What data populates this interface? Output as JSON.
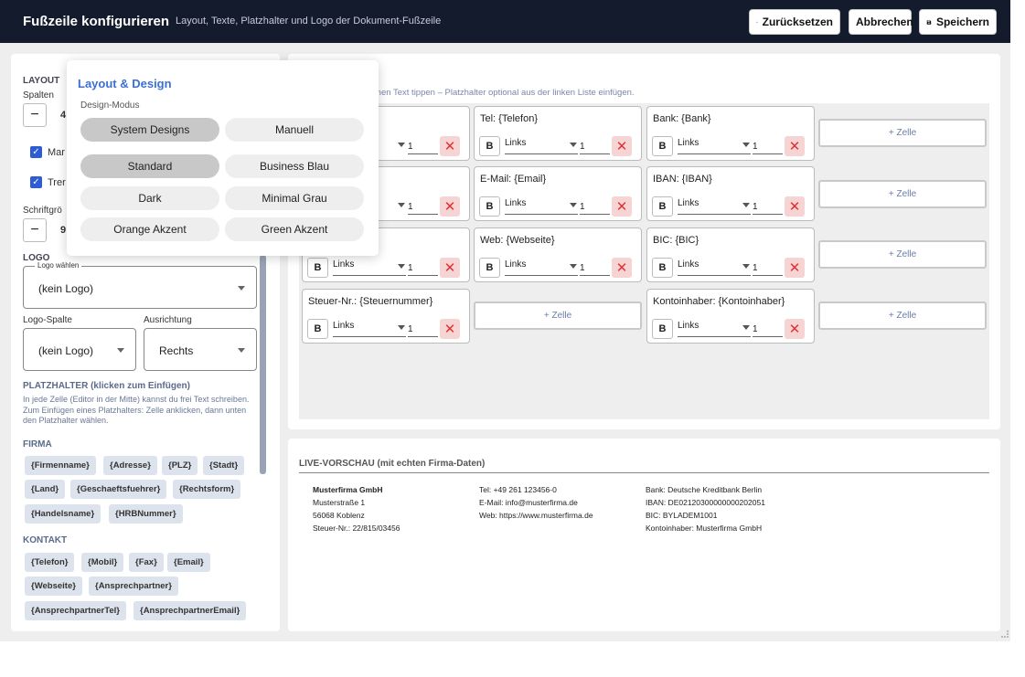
{
  "header": {
    "title": "Fußzeile konfigurieren",
    "subtitle": "Layout, Texte, Platzhalter und Logo der Dokument-Fußzeile",
    "reset_label": "Zurücksetzen",
    "cancel_label": "Abbrechen",
    "save_label": "Speichern"
  },
  "sidebar": {
    "layout_heading": "LAYOUT",
    "columns_label": "Spalten",
    "columns_value": "4",
    "checkbox1_label": "Mar",
    "checkbox2_label": "Trer",
    "fontsize_label": "Schriftgrö",
    "fontsize_value": "9",
    "logo_heading": "LOGO",
    "logo_select_legend": "Logo wählen",
    "logo_select_value": "(kein Logo)",
    "logo_column_label": "Logo-Spalte",
    "logo_column_value": "(kein Logo)",
    "alignment_label": "Ausrichtung",
    "alignment_value": "Rechts",
    "placeholder_heading": "PLATZHALTER (klicken zum Einfügen)",
    "placeholder_hint": "In jede Zelle (Editor in der Mitte) kannst du frei Text schreiben. Zum Einfügen eines Platzhalters: Zelle anklicken, dann unten den Platzhalter wählen.",
    "firma_heading": "FIRMA",
    "firma_chips": [
      "{Firmenname}",
      "{Adresse}",
      "{PLZ}",
      "{Stadt}",
      "{Land}",
      "{Geschaeftsfuehrer}",
      "{Rechtsform}",
      "{Handelsname}",
      "{HRBNummer}"
    ],
    "kontakt_heading": "KONTAKT",
    "kontakt_chips": [
      "{Telefon}",
      "{Mobil}",
      "{Fax}",
      "{Email}",
      "{Webseite}",
      "{Ansprechpartner}",
      "{AnsprechpartnerTel}",
      "{AnsprechpartnerEmail}"
    ]
  },
  "popover": {
    "title": "Layout & Design",
    "mode_label": "Design-Modus",
    "mode_options": [
      "System Designs",
      "Manuell"
    ],
    "designs": [
      "Standard",
      "Business Blau",
      "Dark",
      "Minimal Grau",
      "Orange Akzent",
      "Green Akzent"
    ]
  },
  "editor": {
    "hint": "igenen Text tippen – Platzhalter optional aus der linken Liste einfügen.",
    "bold_label": "B",
    "delete_symbol": "✕",
    "add_cell_label": "+ Zelle",
    "cells": [
      {
        "text": "",
        "align": "",
        "span": "1"
      },
      {
        "text": "Tel: {Telefon}",
        "align": "Links",
        "span": "1"
      },
      {
        "text": "Bank: {Bank}",
        "align": "Links",
        "span": "1"
      },
      {
        "text": "",
        "align": "",
        "span": "1"
      },
      {
        "text": "E-Mail: {Email}",
        "align": "Links",
        "span": "1"
      },
      {
        "text": "IBAN: {IBAN}",
        "align": "Links",
        "span": "1"
      },
      {
        "text": "",
        "align": "Links",
        "span": "1"
      },
      {
        "text": "Web: {Webseite}",
        "align": "Links",
        "span": "1"
      },
      {
        "text": "BIC: {BIC}",
        "align": "Links",
        "span": "1"
      },
      {
        "text": "Steuer-Nr.: {Steuernummer}",
        "align": "Links",
        "span": "1"
      },
      {
        "text": "Kontoinhaber: {Kontoinhaber}",
        "align": "Links",
        "span": "1"
      }
    ]
  },
  "preview": {
    "title": "LIVE-VORSCHAU (mit echten Firma-Daten)",
    "col1": [
      "Musterfirma GmbH",
      "Musterstraße 1",
      "56068 Koblenz",
      "Steuer-Nr.: 22/815/03456"
    ],
    "col2": [
      "Tel: +49 261 123456-0",
      "E-Mail: info@musterfirma.de",
      "Web: https://www.musterfirma.de"
    ],
    "col3": [
      "Bank: Deutsche Kreditbank Berlin",
      "IBAN: DE02120300000000202051",
      "BIC: BYLADEM1001",
      "Kontoinhaber: Musterfirma GmbH"
    ]
  }
}
